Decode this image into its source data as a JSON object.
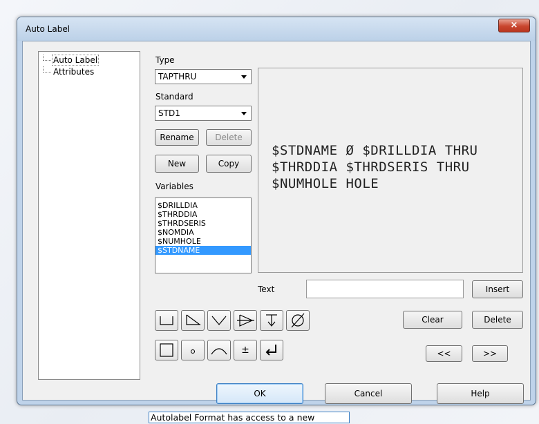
{
  "window": {
    "title": "Auto Label",
    "close_glyph": "×"
  },
  "tree": {
    "items": [
      {
        "label": "Auto Label",
        "selected": true
      },
      {
        "label": "Attributes",
        "selected": false
      }
    ]
  },
  "type": {
    "label": "Type",
    "value": "TAPTHRU"
  },
  "standard": {
    "label": "Standard",
    "value": "STD1"
  },
  "buttons": {
    "rename": "Rename",
    "delete_std": "Delete",
    "new": "New",
    "copy": "Copy",
    "insert": "Insert",
    "clear": "Clear",
    "delete": "Delete",
    "prev": "<<",
    "next": ">>",
    "ok": "OK",
    "cancel": "Cancel",
    "help": "Help"
  },
  "variables": {
    "label": "Variables",
    "items": [
      "$DRILLDIA",
      "$THRDDIA",
      "$THRDSERIS",
      "$NOMDIA",
      "$NUMHOLE",
      "$STDNAME"
    ],
    "selected": "$STDNAME"
  },
  "preview": {
    "lines": [
      "$STDNAME Ø $DRILLDIA THRU",
      "$THRDDIA $THRDSERIS THRU",
      "$NUMHOLE HOLE"
    ]
  },
  "text_field": {
    "label": "Text",
    "value": ""
  },
  "symbols": {
    "row1": [
      "counterbore-icon",
      "taper-icon",
      "countersink-icon",
      "slope-icon",
      "depth-icon",
      "diameter-icon"
    ],
    "row2": [
      "square-icon",
      "degree-icon",
      "arc-icon",
      "plus-minus-icon",
      "newline-icon"
    ],
    "plus_minus_glyph": "±",
    "degree_glyph": "○"
  },
  "caption": "Autolabel Format has access to a new variable",
  "colors": {
    "selection": "#3399ff",
    "close_button": "#c9462f",
    "frame": "#bfd3ea"
  }
}
